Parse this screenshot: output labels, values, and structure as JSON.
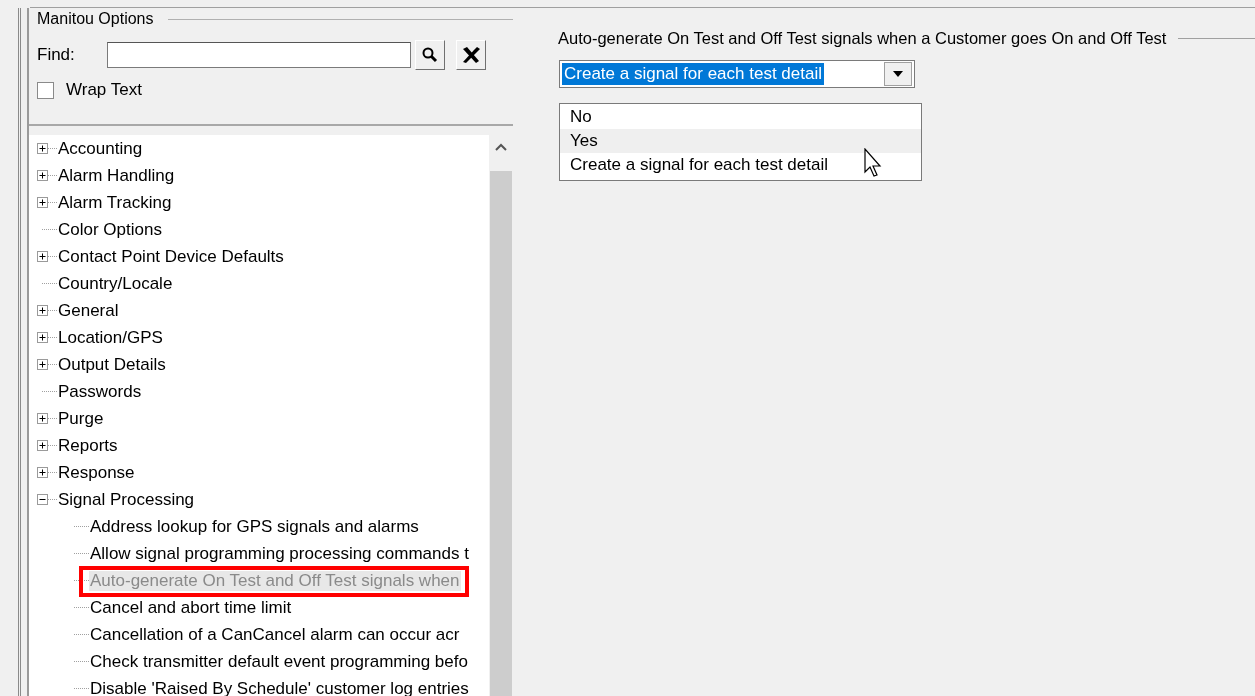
{
  "options_panel": {
    "title": "Manitou Options",
    "find": {
      "label": "Find:"
    },
    "wrap_text": {
      "label": "Wrap Text",
      "checked": false
    }
  },
  "tree": [
    {
      "label": "Accounting",
      "kind": "folder",
      "expanded": false,
      "selected": false
    },
    {
      "label": "Alarm Handling",
      "kind": "folder",
      "expanded": false,
      "selected": false
    },
    {
      "label": "Alarm Tracking",
      "kind": "folder",
      "expanded": false,
      "selected": false
    },
    {
      "label": "Color Options",
      "kind": "leaf",
      "selected": false
    },
    {
      "label": "Contact Point Device Defaults",
      "kind": "folder",
      "expanded": false,
      "selected": false
    },
    {
      "label": "Country/Locale",
      "kind": "leaf",
      "selected": false
    },
    {
      "label": "General",
      "kind": "folder",
      "expanded": false,
      "selected": false
    },
    {
      "label": "Location/GPS",
      "kind": "folder",
      "expanded": false,
      "selected": false
    },
    {
      "label": "Output Details",
      "kind": "folder",
      "expanded": false,
      "selected": false
    },
    {
      "label": "Passwords",
      "kind": "leaf",
      "selected": false
    },
    {
      "label": "Purge",
      "kind": "folder",
      "expanded": false,
      "selected": false
    },
    {
      "label": "Reports",
      "kind": "folder",
      "expanded": false,
      "selected": false
    },
    {
      "label": "Response",
      "kind": "folder",
      "expanded": false,
      "selected": false
    },
    {
      "label": "Signal Processing",
      "kind": "folder",
      "expanded": true,
      "selected": false,
      "children": [
        {
          "label": "Address lookup for GPS signals and alarms",
          "kind": "leaf",
          "selected": false
        },
        {
          "label": "Allow signal programming processing commands t",
          "kind": "leaf",
          "selected": false
        },
        {
          "label": "Auto-generate On Test and Off Test signals when",
          "kind": "leaf",
          "selected": true,
          "highlighted": true
        },
        {
          "label": "Cancel and abort time limit",
          "kind": "leaf",
          "selected": false
        },
        {
          "label": "Cancellation of a CanCancel alarm can occur acr",
          "kind": "leaf",
          "selected": false
        },
        {
          "label": "Check transmitter default event programming befo",
          "kind": "leaf",
          "selected": false
        },
        {
          "label": "Disable 'Raised By Schedule' customer log entries",
          "kind": "leaf",
          "selected": false
        }
      ]
    }
  ],
  "setting": {
    "label": "Auto-generate On Test and Off Test signals when a Customer goes On and Off Test",
    "value": "Create a signal for each test detail",
    "open": true,
    "options": [
      {
        "label": "No",
        "highlighted": false
      },
      {
        "label": "Yes",
        "highlighted": true
      },
      {
        "label": "Create a signal for each test detail",
        "highlighted": false
      }
    ]
  }
}
